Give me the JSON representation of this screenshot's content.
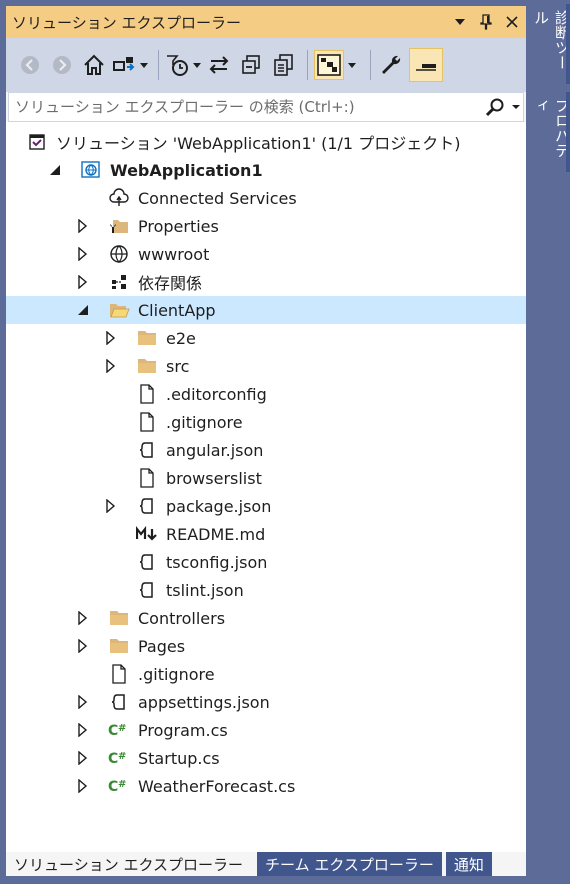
{
  "panel": {
    "title": "ソリューション エクスプローラー",
    "title_buttons": [
      "dropdown-arrow-icon",
      "pin-icon",
      "close-icon"
    ]
  },
  "toolbar": {
    "buttons": [
      {
        "name": "back",
        "icon": "back-arrow-icon",
        "enabled": false
      },
      {
        "name": "forward",
        "icon": "forward-arrow-icon",
        "enabled": false
      },
      {
        "name": "home",
        "icon": "home-icon",
        "enabled": true
      },
      {
        "name": "switch-views",
        "icon": "switch-views-icon",
        "enabled": true,
        "dropdown": true
      },
      {
        "name": "pending-changes-filter",
        "icon": "clock-filter-icon",
        "enabled": true,
        "dropdown": true
      },
      {
        "name": "sync-with-active-document",
        "icon": "sync-icon",
        "enabled": true
      },
      {
        "name": "collapse-all",
        "icon": "collapse-all-icon",
        "enabled": true
      },
      {
        "name": "show-all-files",
        "icon": "show-all-files-icon",
        "enabled": true
      },
      {
        "name": "preview-selected-items",
        "icon": "preview-icon",
        "enabled": true,
        "dropdown": true,
        "active": true
      },
      {
        "name": "properties",
        "icon": "wrench-icon",
        "enabled": true
      },
      {
        "name": "preview-pane",
        "icon": "preview-pane-icon",
        "enabled": true,
        "active": true
      }
    ]
  },
  "search": {
    "placeholder": "ソリューション エクスプローラー の検索 (Ctrl+:)"
  },
  "tree": {
    "items": [
      {
        "label": "ソリューション 'WebApplication1' (1/1 プロジェクト)",
        "depth": 0,
        "icon": "solution-icon",
        "expander": "none",
        "bold": false
      },
      {
        "label": "WebApplication1",
        "depth": 1,
        "icon": "web-project-icon",
        "expander": "expanded",
        "bold": true
      },
      {
        "label": "Connected Services",
        "depth": 2,
        "icon": "connected-services-icon",
        "expander": "none",
        "bold": false
      },
      {
        "label": "Properties",
        "depth": 2,
        "icon": "properties-folder-icon",
        "expander": "collapsed",
        "bold": false
      },
      {
        "label": "wwwroot",
        "depth": 2,
        "icon": "globe-icon",
        "expander": "collapsed",
        "bold": false
      },
      {
        "label": "依存関係",
        "depth": 2,
        "icon": "dependencies-icon",
        "expander": "collapsed",
        "bold": false
      },
      {
        "label": "ClientApp",
        "depth": 2,
        "icon": "folder-open-icon",
        "expander": "expanded",
        "bold": false,
        "selected": true
      },
      {
        "label": "e2e",
        "depth": 3,
        "icon": "folder-icon",
        "expander": "collapsed",
        "bold": false
      },
      {
        "label": "src",
        "depth": 3,
        "icon": "folder-icon",
        "expander": "collapsed",
        "bold": false
      },
      {
        "label": ".editorconfig",
        "depth": 3,
        "icon": "file-icon",
        "expander": "none",
        "bold": false
      },
      {
        "label": ".gitignore",
        "depth": 3,
        "icon": "file-icon",
        "expander": "none",
        "bold": false
      },
      {
        "label": "angular.json",
        "depth": 3,
        "icon": "json-file-icon",
        "expander": "none",
        "bold": false
      },
      {
        "label": "browserslist",
        "depth": 3,
        "icon": "file-icon",
        "expander": "none",
        "bold": false
      },
      {
        "label": "package.json",
        "depth": 3,
        "icon": "json-file-icon",
        "expander": "collapsed",
        "bold": false
      },
      {
        "label": "README.md",
        "depth": 3,
        "icon": "markdown-icon",
        "expander": "none",
        "bold": false
      },
      {
        "label": "tsconfig.json",
        "depth": 3,
        "icon": "json-file-icon",
        "expander": "none",
        "bold": false
      },
      {
        "label": "tslint.json",
        "depth": 3,
        "icon": "json-file-icon",
        "expander": "none",
        "bold": false
      },
      {
        "label": "Controllers",
        "depth": 2,
        "icon": "folder-icon",
        "expander": "collapsed",
        "bold": false
      },
      {
        "label": "Pages",
        "depth": 2,
        "icon": "folder-icon",
        "expander": "collapsed",
        "bold": false
      },
      {
        "label": ".gitignore",
        "depth": 2,
        "icon": "file-icon",
        "expander": "none",
        "bold": false
      },
      {
        "label": "appsettings.json",
        "depth": 2,
        "icon": "json-file-icon",
        "expander": "collapsed",
        "bold": false
      },
      {
        "label": "Program.cs",
        "depth": 2,
        "icon": "csharp-file-icon",
        "expander": "collapsed",
        "bold": false
      },
      {
        "label": "Startup.cs",
        "depth": 2,
        "icon": "csharp-file-icon",
        "expander": "collapsed",
        "bold": false
      },
      {
        "label": "WeatherForecast.cs",
        "depth": 2,
        "icon": "csharp-file-icon",
        "expander": "collapsed",
        "bold": false
      }
    ]
  },
  "bottom_tabs": [
    {
      "label": "ソリューション エクスプローラー",
      "active": true
    },
    {
      "label": "チーム エクスプローラー",
      "active": false
    },
    {
      "label": "通知",
      "active": false
    }
  ],
  "side_tabs": [
    {
      "label": "診断ツール"
    },
    {
      "label": "プロパティ"
    }
  ],
  "colors": {
    "title_bar": "#f5cc84",
    "toolbar": "#cfd6e5",
    "selection": "#cce8ff",
    "folder": "#dcb67a",
    "csharp": "#388a34",
    "chrome": "#5d6b99"
  }
}
